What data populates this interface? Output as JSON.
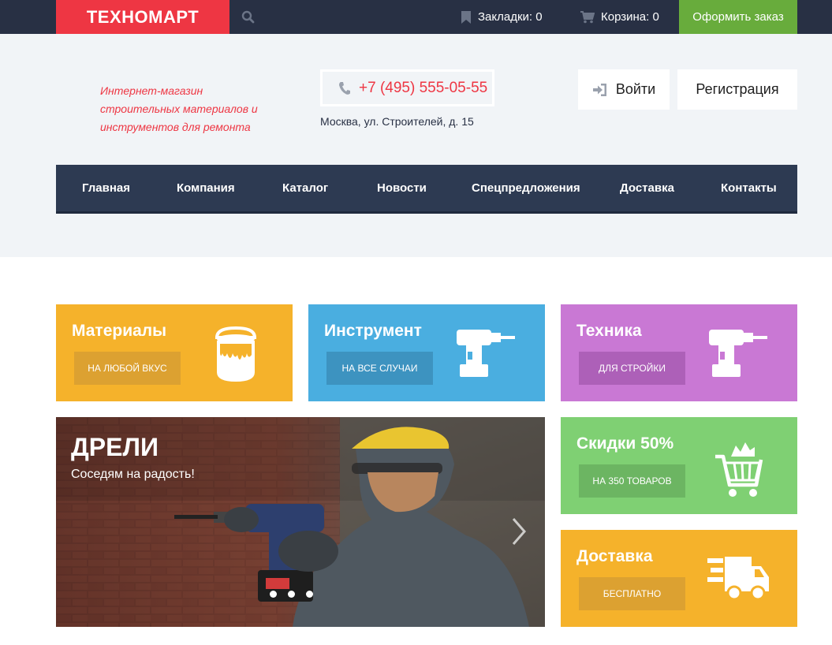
{
  "topbar": {
    "logo": "ТЕХНОМАРТ",
    "bookmarks": "Закладки: 0",
    "cart": "Корзина: 0",
    "order_button": "Оформить заказ"
  },
  "header": {
    "tagline_lines": [
      "Интернет-магазин",
      "строительных материалов и",
      "инструментов для ремонта"
    ],
    "phone": "+7 (495) 555-05-55",
    "address": "Москва, ул. Строителей, д. 15",
    "login": "Войти",
    "register": "Регистрация"
  },
  "nav": [
    "Главная",
    "Компания",
    "Каталог",
    "Новости",
    "Спецпредложения",
    "Доставка",
    "Контакты"
  ],
  "tiles": [
    {
      "title": "Материалы",
      "button": "НА ЛЮБОЙ ВКУС",
      "icon": "paint-bucket-icon",
      "color": "#f5b22b"
    },
    {
      "title": "Инструмент",
      "button": "НА ВСЕ СЛУЧАИ",
      "icon": "drill-icon",
      "color": "#4aaee0"
    },
    {
      "title": "Техника",
      "button": "ДЛЯ СТРОЙКИ",
      "icon": "drill-icon",
      "color": "#c978d4"
    },
    {
      "title": "Скидки 50%",
      "button": "НА 350 ТОВАРОВ",
      "icon": "cart-icon",
      "color": "#7fd073"
    },
    {
      "title": "Доставка",
      "button": "БЕСПЛАТНО",
      "icon": "truck-icon",
      "color": "#f5b22b"
    }
  ],
  "slider": {
    "title": "ДРЕЛИ",
    "subtitle": "Соседям на радость!",
    "slide_count": 3,
    "active_slide": 1
  },
  "colors": {
    "brand_red": "#ee3643",
    "dark_navy": "#283044",
    "order_green": "#68ac3c"
  }
}
